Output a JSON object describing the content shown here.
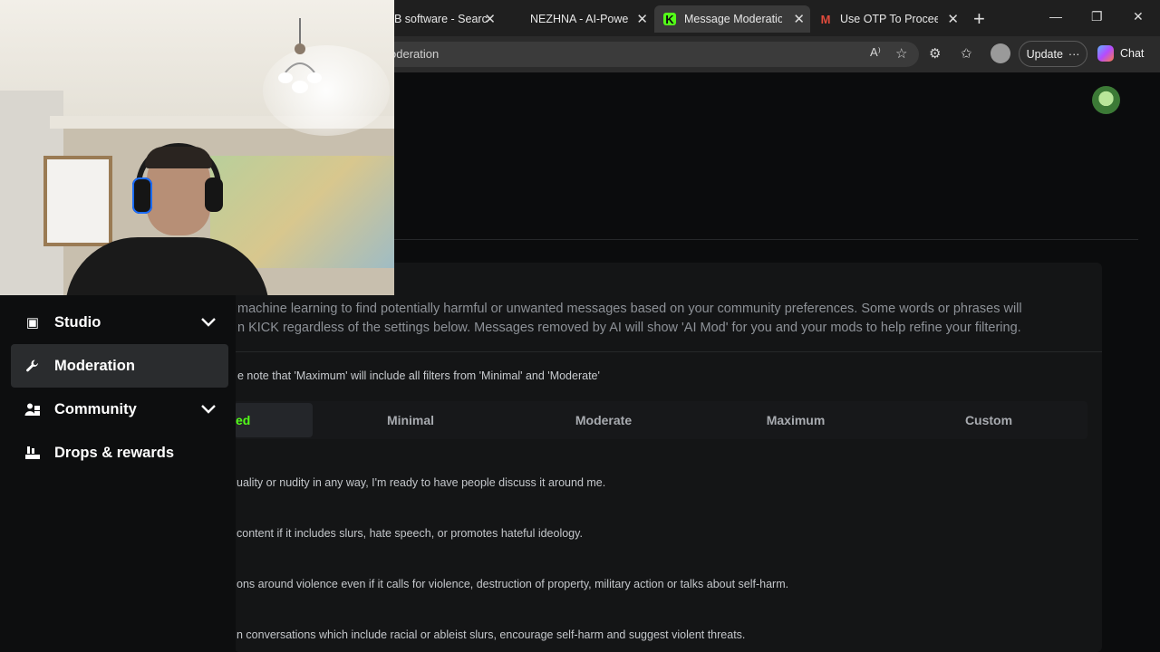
{
  "browser": {
    "tabs": [
      {
        "title": "B software - Searc",
        "active": false
      },
      {
        "title": "NEZHNA - AI-Powere",
        "active": false
      },
      {
        "title": "Message Moderation",
        "active": true,
        "favicon": "K"
      },
      {
        "title": "Use OTP To Proceed",
        "active": false,
        "favicon": "M"
      }
    ],
    "close_glyph": "✕",
    "new_tab": "+",
    "window_controls": [
      "—",
      "❐",
      "✕"
    ],
    "url_fragment": "oderation",
    "update_label": "Update",
    "update_more": "···",
    "chat_label": "Chat",
    "toolbar_icons": [
      "read-aloud-icon",
      "favorite-star-icon",
      "extensions-icon",
      "favorites-icon"
    ],
    "toolbar_glyphs": [
      "A⁾",
      "☆",
      "⚙",
      "✩"
    ]
  },
  "sidebar": {
    "items": [
      {
        "label": "Studio",
        "icon": "studio-icon",
        "glyph": "▣",
        "expandable": true,
        "active": false
      },
      {
        "label": "Moderation",
        "icon": "wrench-icon",
        "glyph": "🔧",
        "expandable": false,
        "active": true
      },
      {
        "label": "Community",
        "icon": "community-icon",
        "glyph": "👥",
        "expandable": true,
        "active": false
      },
      {
        "label": "Drops & rewards",
        "icon": "drops-icon",
        "glyph": "⛾",
        "expandable": false,
        "active": false
      }
    ],
    "chevron": "⌄"
  },
  "main": {
    "description_lines": [
      "machine learning to find potentially harmful or unwanted messages based on your community preferences. Some words or phrases will",
      "n KICK regardless of the settings below. Messages removed by AI will show 'AI Mod' for you and your mods to help refine your filtering."
    ],
    "note": "e note that 'Maximum' will include all filters from 'Minimal' and 'Moderate'",
    "levels": [
      {
        "label": "ed",
        "active": true
      },
      {
        "label": "Minimal",
        "active": false
      },
      {
        "label": "Moderate",
        "active": false
      },
      {
        "label": "Maximum",
        "active": false
      },
      {
        "label": "Custom",
        "active": false
      }
    ],
    "categories": [
      "uality or nudity in any way, I'm ready to have people discuss it around me.",
      "content if it includes slurs, hate speech, or promotes hateful ideology.",
      "ons around violence even if it calls for violence, destruction of property, military action or talks about self-harm.",
      "n conversations which include racial or ableist slurs, encourage self-harm and suggest violent threats."
    ]
  },
  "colors": {
    "accent": "#53fc18",
    "page_bg": "#0b0c0d",
    "panel_bg": "#141516"
  }
}
